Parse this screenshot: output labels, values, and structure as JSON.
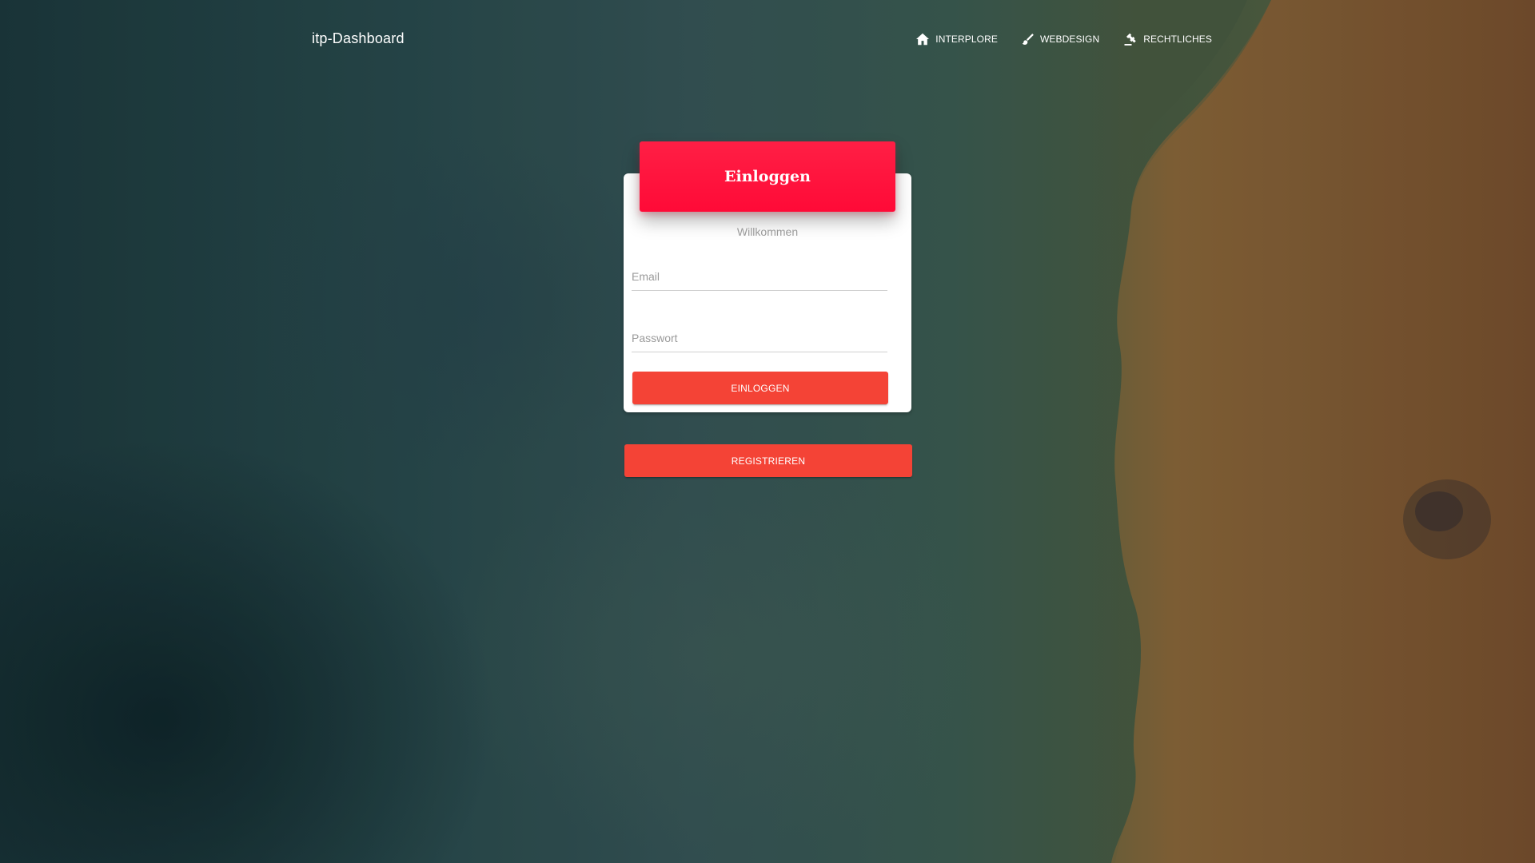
{
  "navbar": {
    "brand": "itp-Dashboard",
    "links": [
      {
        "label": "Interplore",
        "icon": "home-icon"
      },
      {
        "label": "Webdesign",
        "icon": "brush-icon"
      },
      {
        "label": "Rechtliches",
        "icon": "gavel-icon"
      }
    ]
  },
  "login_card": {
    "title": "Einloggen",
    "subtitle": "Willkommen",
    "email_placeholder": "Email",
    "password_placeholder": "Passwort",
    "login_button": "Einloggen"
  },
  "register_button": "Registrieren",
  "colors": {
    "header_accent": "#ff0a37",
    "button": "#f44336"
  }
}
